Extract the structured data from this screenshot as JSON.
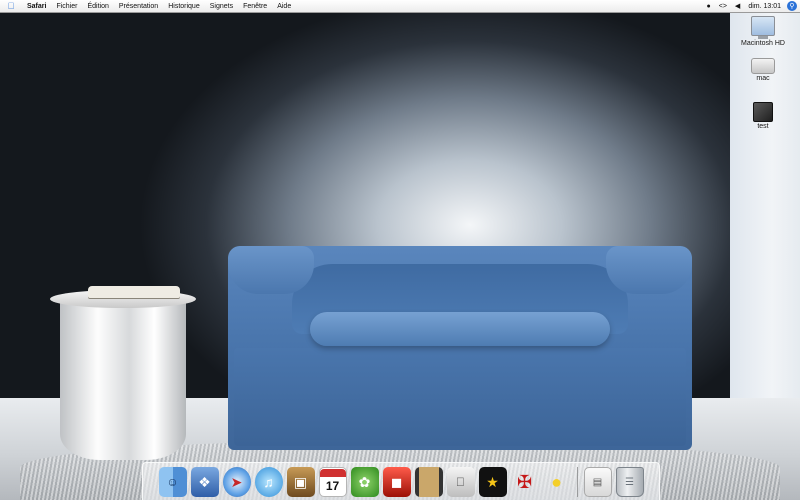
{
  "menubar": {
    "apple_icon": "apple-icon",
    "app_name": "Safari",
    "items": [
      "Fichier",
      "Édition",
      "Présentation",
      "Historique",
      "Signets",
      "Fenêtre",
      "Aide"
    ],
    "clock": "dim. 13:01",
    "extras": [
      "user-icon",
      "bluetooth-icon",
      "volume-icon",
      "spotlight-icon"
    ]
  },
  "desktop": {
    "icons": [
      {
        "label": "Macintosh HD",
        "icon": "hard-drive-icon"
      },
      {
        "label": "mac",
        "icon": "disk-icon"
      },
      {
        "label": "test",
        "icon": "box-icon"
      }
    ]
  },
  "dock": {
    "calendar_day": "17",
    "apps": [
      {
        "name": "Finder",
        "icon": "finder-icon"
      },
      {
        "name": "Aperçu",
        "icon": "preview-icon"
      },
      {
        "name": "Safari",
        "icon": "safari-icon"
      },
      {
        "name": "iTunes",
        "icon": "itunes-icon"
      },
      {
        "name": "iPhoto",
        "icon": "iphoto-icon"
      },
      {
        "name": "iCal",
        "icon": "ical-icon"
      },
      {
        "name": "Adium",
        "icon": "adium-icon"
      },
      {
        "name": "Front Row",
        "icon": "front-row-icon"
      },
      {
        "name": "Photo Booth",
        "icon": "film-icon"
      },
      {
        "name": "Boot Camp",
        "icon": "bootcamp-icon"
      },
      {
        "name": "Star",
        "icon": "star-icon"
      },
      {
        "name": "Wolfenstein",
        "icon": "wolf-icon"
      },
      {
        "name": "Cyberduck",
        "icon": "duck-icon"
      }
    ],
    "stacks": [
      {
        "name": "Documents",
        "icon": "documents-icon"
      },
      {
        "name": "Corbeille",
        "icon": "trash-icon"
      }
    ]
  }
}
